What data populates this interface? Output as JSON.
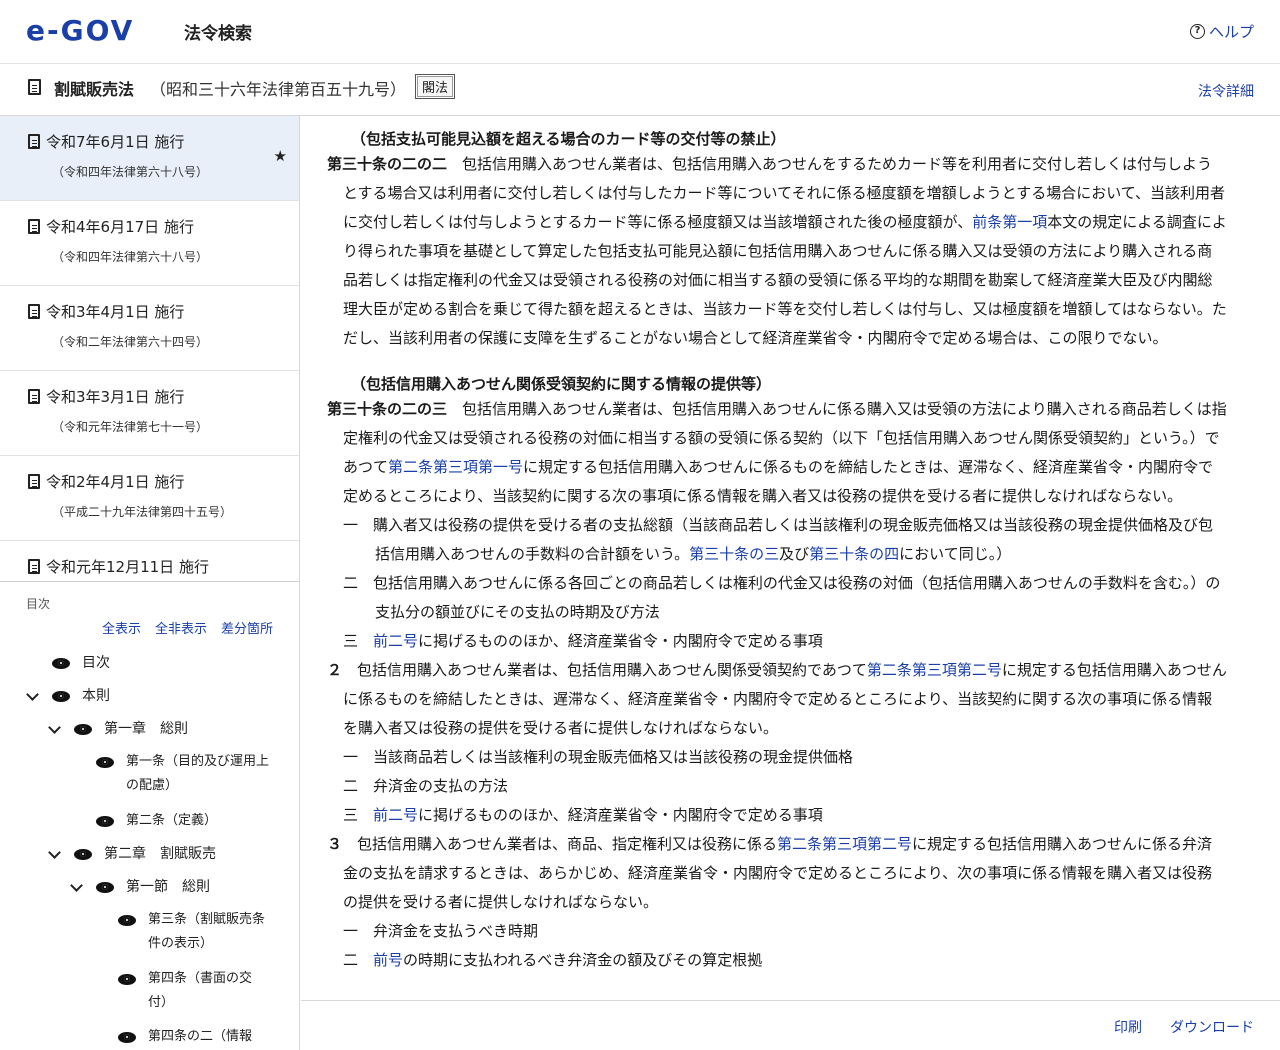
{
  "header": {
    "logo_text": "e-GOV",
    "site_name": "法令検索",
    "help_label": "ヘルプ"
  },
  "law": {
    "title": "割賦販売法",
    "number": "（昭和三十六年法律第百五十九号）",
    "badge": "閣法",
    "detail_link": "法令詳細"
  },
  "versions": [
    {
      "date": "令和7年6月1日 施行",
      "law": "（令和四年法律第六十八号）",
      "active": true
    },
    {
      "date": "令和4年6月17日 施行",
      "law": "（令和四年法律第六十八号）"
    },
    {
      "date": "令和3年4月1日 施行",
      "law": "（令和二年法律第六十四号）"
    },
    {
      "date": "令和3年3月1日 施行",
      "law": "（令和元年法律第七十一号）"
    },
    {
      "date": "令和2年4月1日 施行",
      "law": "（平成二十九年法律第四十五号）"
    },
    {
      "date": "令和元年12月11日 施行",
      "law": ""
    }
  ],
  "toc": {
    "label": "目次",
    "show_all": "全表示",
    "hide_all": "全非表示",
    "diff": "差分箇所",
    "items": [
      {
        "label": "目次"
      },
      {
        "label": "本則"
      },
      {
        "label": "第一章　総則"
      },
      {
        "label": "第一条（目的及び運用上の配慮）"
      },
      {
        "label": "第二条（定義）"
      },
      {
        "label": "第二章　割賦販売"
      },
      {
        "label": "第一節　総則"
      },
      {
        "label": "第三条（割賦販売条件の表示）"
      },
      {
        "label": "第四条（書面の交付）"
      },
      {
        "label": "第四条の二（情報"
      }
    ]
  },
  "content": {
    "a1_caption": "（包括支払可能見込額を超える場合のカード等の交付等の禁止）",
    "a1_num": "第三十条の二の二",
    "a1_t1": "　包括信用購入あつせん業者は、包括信用購入あつせんをするためカード等を利用者に交付し若しくは付与しようとする場合又は利用者に交付し若しくは付与したカード等についてそれに係る極度額を増額しようとする場合において、当該利用者に交付し若しくは付与しようとするカード等に係る極度額又は当該増額された後の極度額が、",
    "a1_link1": "前条第一項",
    "a1_t2": "本文の規定による調査により得られた事項を基礎として算定した包括支払可能見込額に包括信用購入あつせんに係る購入又は受領の方法により購入される商品若しくは指定権利の代金又は受領される役務の対価に相当する額の受領に係る平均的な期間を勘案して経済産業大臣及び内閣総理大臣が定める割合を乗じて得た額を超えるときは、当該カード等を交付し若しくは付与し、又は極度額を増額してはならない。ただし、当該利用者の保護に支障を生ずることがない場合として経済産業省令・内閣府令で定める場合は、この限りでない。",
    "a2_caption": "（包括信用購入あつせん関係受領契約に関する情報の提供等）",
    "a2_num": "第三十条の二の三",
    "a2_t1": "　包括信用購入あつせん業者は、包括信用購入あつせんに係る購入又は受領の方法により購入される商品若しくは指定権利の代金又は受領される役務の対価に相当する額の受領に係る契約（以下「包括信用購入あつせん関係受領契約」という。）であつて",
    "a2_link1": "第二条第三項第一号",
    "a2_t2": "に規定する包括信用購入あつせんに係るものを締結したときは、遅滞なく、経済産業省令・内閣府令で定めるところにより、当該契約に関する次の事項に係る情報を購入者又は役務の提供を受ける者に提供しなければならない。",
    "p1_i1_num": "一",
    "p1_i1_t1": "　購入者又は役務の提供を受ける者の支払総額（当該商品若しくは当該権利の現金販売価格又は当該役務の現金提供価格及び包括信用購入あつせんの手数料の合計額をいう。",
    "p1_i1_link1": "第三十条の三",
    "p1_i1_t2": "及び",
    "p1_i1_link2": "第三十条の四",
    "p1_i1_t3": "において同じ。）",
    "p1_i2_num": "二",
    "p1_i2_t1": "　包括信用購入あつせんに係る各回ごとの商品若しくは権利の代金又は役務の対価（包括信用購入あつせんの手数料を含む。）の支払分の額並びにその支払の時期及び方法",
    "p1_i3_num": "三",
    "p1_i3_link": "前二号",
    "p1_i3_t1": "に掲げるもののほか、経済産業省令・内閣府令で定める事項",
    "p2_num": "２",
    "p2_t1": "　包括信用購入あつせん業者は、包括信用購入あつせん関係受領契約であつて",
    "p2_link1": "第二条第三項第二号",
    "p2_t2": "に規定する包括信用購入あつせんに係るものを締結したときは、遅滞なく、経済産業省令・内閣府令で定めるところにより、当該契約に関する次の事項に係る情報を購入者又は役務の提供を受ける者に提供しなければならない。",
    "p2_i1_num": "一",
    "p2_i1_t1": "　当該商品若しくは当該権利の現金販売価格又は当該役務の現金提供価格",
    "p2_i2_num": "二",
    "p2_i2_t1": "　弁済金の支払の方法",
    "p2_i3_num": "三",
    "p2_i3_link": "前二号",
    "p2_i3_t1": "に掲げるもののほか、経済産業省令・内閣府令で定める事項",
    "p3_num": "３",
    "p3_t1": "　包括信用購入あつせん業者は、商品、指定権利又は役務に係る",
    "p3_link1": "第二条第三項第二号",
    "p3_t2": "に規定する包括信用購入あつせんに係る弁済金の支払を請求するときは、あらかじめ、経済産業省令・内閣府令で定めるところにより、次の事項に係る情報を購入者又は役務の提供を受ける者に提供しなければならない。",
    "p3_i1_num": "一",
    "p3_i1_t1": "　弁済金を支払うべき時期",
    "p3_i2_num": "二",
    "p3_i2_link": "前号",
    "p3_i2_t1": "の時期に支払われるべき弁済金の額及びその算定根拠"
  },
  "footer": {
    "print": "印刷",
    "download": "ダウンロード"
  },
  "colors": {
    "link": "#1a3fa8",
    "active_version_bg": "#e8eff9"
  }
}
